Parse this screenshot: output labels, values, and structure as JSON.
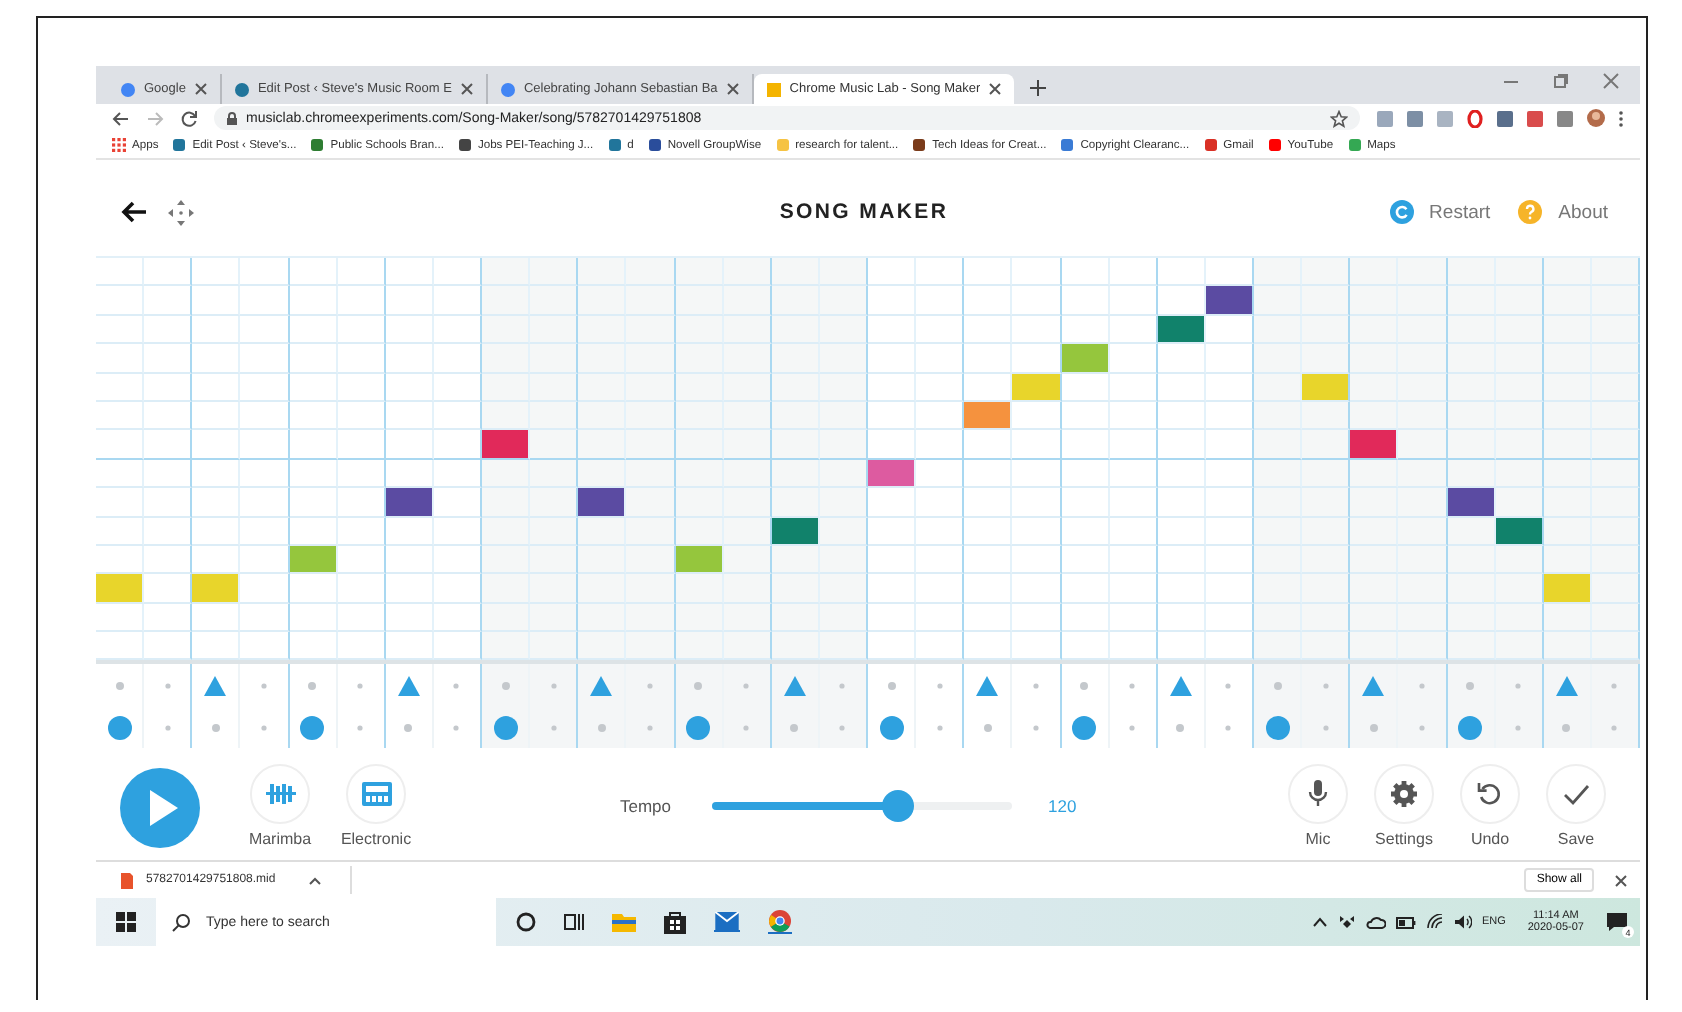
{
  "browser": {
    "tabs": [
      {
        "title": "Google",
        "selected": false
      },
      {
        "title": "Edit Post ‹ Steve's Music Room E",
        "selected": false
      },
      {
        "title": "Celebrating Johann Sebastian Ba",
        "selected": false
      },
      {
        "title": "Chrome Music Lab - Song Maker",
        "selected": true
      }
    ],
    "url": "musiclab.chromeexperiments.com/Song-Maker/song/5782701429751808",
    "bookmarks": [
      "Apps",
      "Edit Post ‹ Steve's...",
      "Public Schools Bran...",
      "Jobs PEI-Teaching J...",
      "d",
      "Novell GroupWise",
      "research for talent...",
      "Tech Ideas for Creat...",
      "Copyright Clearanc...",
      "Gmail",
      "YouTube",
      "Maps"
    ]
  },
  "app": {
    "title": "SONG MAKER",
    "header_actions": [
      {
        "label": "Restart",
        "kind": "restart"
      },
      {
        "label": "About",
        "kind": "about"
      }
    ]
  },
  "melody": {
    "rows": [
      {
        "on": [
          false,
          false,
          false,
          false,
          false,
          false,
          false,
          false,
          false,
          false,
          false,
          false,
          false,
          false,
          false,
          false,
          false,
          false,
          false,
          false,
          false,
          false,
          false,
          false,
          false,
          false,
          false,
          false,
          false,
          false,
          false,
          false
        ]
      },
      {
        "color": "#5b4ba2",
        "on": [
          false,
          false,
          false,
          false,
          false,
          false,
          false,
          false,
          false,
          false,
          false,
          false,
          false,
          false,
          false,
          false,
          false,
          false,
          false,
          false,
          false,
          false,
          false,
          true,
          false,
          false,
          false,
          false,
          false,
          false,
          false,
          false
        ]
      },
      {
        "color": "#11826b",
        "on": [
          false,
          false,
          false,
          false,
          false,
          false,
          false,
          false,
          false,
          false,
          false,
          false,
          false,
          false,
          false,
          false,
          false,
          false,
          false,
          false,
          false,
          false,
          true,
          false,
          false,
          false,
          false,
          false,
          false,
          false,
          false,
          false
        ]
      },
      {
        "color": "#95c63d",
        "on": [
          false,
          false,
          false,
          false,
          false,
          false,
          false,
          false,
          false,
          false,
          false,
          false,
          false,
          false,
          false,
          false,
          false,
          false,
          false,
          false,
          true,
          false,
          false,
          false,
          false,
          false,
          false,
          false,
          false,
          false,
          false,
          false
        ]
      },
      {
        "color": "#e8d52b",
        "on": [
          false,
          false,
          false,
          false,
          false,
          false,
          false,
          false,
          false,
          false,
          false,
          false,
          false,
          false,
          false,
          false,
          false,
          false,
          false,
          true,
          false,
          false,
          false,
          false,
          false,
          true,
          false,
          false,
          false,
          false,
          false,
          false
        ]
      },
      {
        "color": "#f5923e",
        "on": [
          false,
          false,
          false,
          false,
          false,
          false,
          false,
          false,
          false,
          false,
          false,
          false,
          false,
          false,
          false,
          false,
          false,
          false,
          true,
          false,
          false,
          false,
          false,
          false,
          false,
          false,
          false,
          false,
          false,
          false,
          false,
          false
        ]
      },
      {
        "color": "#e1295a",
        "on": [
          false,
          false,
          false,
          false,
          false,
          false,
          false,
          false,
          true,
          false,
          false,
          false,
          false,
          false,
          false,
          false,
          false,
          false,
          false,
          false,
          false,
          false,
          false,
          false,
          false,
          false,
          true,
          false,
          false,
          false,
          false,
          false
        ]
      },
      {
        "color": "#dd5ba0",
        "on": [
          false,
          false,
          false,
          false,
          false,
          false,
          false,
          false,
          false,
          false,
          false,
          false,
          false,
          false,
          false,
          false,
          true,
          false,
          false,
          false,
          false,
          false,
          false,
          false,
          false,
          false,
          false,
          false,
          false,
          false,
          false,
          false
        ]
      },
      {
        "color": "#5b4ba2",
        "on": [
          false,
          false,
          false,
          false,
          false,
          false,
          true,
          false,
          false,
          false,
          true,
          false,
          false,
          false,
          false,
          false,
          false,
          false,
          false,
          false,
          false,
          false,
          false,
          false,
          false,
          false,
          false,
          false,
          true,
          false,
          false,
          false
        ]
      },
      {
        "color": "#11826b",
        "on": [
          false,
          false,
          false,
          false,
          false,
          false,
          false,
          false,
          false,
          false,
          false,
          false,
          false,
          false,
          true,
          false,
          false,
          false,
          false,
          false,
          false,
          false,
          false,
          false,
          false,
          false,
          false,
          false,
          false,
          true,
          false,
          false
        ]
      },
      {
        "color": "#95c63d",
        "on": [
          false,
          false,
          false,
          false,
          true,
          false,
          false,
          false,
          false,
          false,
          false,
          false,
          true,
          false,
          false,
          false,
          false,
          false,
          false,
          false,
          false,
          false,
          false,
          false,
          false,
          false,
          false,
          false,
          false,
          false,
          false,
          false
        ]
      },
      {
        "color": "#e8d52b",
        "on": [
          true,
          false,
          true,
          false,
          false,
          false,
          false,
          false,
          false,
          false,
          false,
          false,
          false,
          false,
          false,
          false,
          false,
          false,
          false,
          false,
          false,
          false,
          false,
          false,
          false,
          false,
          false,
          false,
          false,
          false,
          true,
          false
        ]
      },
      {
        "on": [
          false,
          false,
          false,
          false,
          false,
          false,
          false,
          false,
          false,
          false,
          false,
          false,
          false,
          false,
          false,
          false,
          false,
          false,
          false,
          false,
          false,
          false,
          false,
          false,
          false,
          false,
          false,
          false,
          false,
          false,
          false,
          false
        ]
      },
      {
        "on": [
          false,
          false,
          false,
          false,
          false,
          false,
          false,
          false,
          false,
          false,
          false,
          false,
          false,
          false,
          false,
          false,
          false,
          false,
          false,
          false,
          false,
          false,
          false,
          false,
          false,
          false,
          false,
          false,
          false,
          false,
          false,
          false
        ]
      }
    ]
  },
  "rhythm": {
    "rows": [
      {
        "kind": "triangle",
        "on": [
          false,
          false,
          true,
          false,
          false,
          false,
          true,
          false,
          false,
          false,
          true,
          false,
          false,
          false,
          true,
          false,
          false,
          false,
          true,
          false,
          false,
          false,
          true,
          false,
          false,
          false,
          true,
          false,
          false,
          false,
          true,
          false
        ]
      },
      {
        "kind": "circle",
        "on": [
          true,
          false,
          false,
          false,
          true,
          false,
          false,
          false,
          true,
          false,
          false,
          false,
          true,
          false,
          false,
          false,
          true,
          false,
          false,
          false,
          true,
          false,
          false,
          false,
          true,
          false,
          false,
          false,
          true,
          false,
          false,
          false
        ]
      }
    ]
  },
  "controls": {
    "instruments": [
      {
        "label": "Marimba",
        "kind": "marimba"
      },
      {
        "label": "Electronic",
        "kind": "electronic"
      }
    ],
    "tempo": {
      "label": "Tempo",
      "level": 0.62,
      "reading": "120"
    },
    "actions": [
      {
        "label": "Mic",
        "kind": "mic"
      },
      {
        "label": "Settings",
        "kind": "settings"
      },
      {
        "label": "Undo",
        "kind": "undo"
      },
      {
        "label": "Save",
        "kind": "save"
      }
    ]
  },
  "download_bar": {
    "file": "5782701429751808.mid",
    "show_all": "Show all"
  },
  "taskbar": {
    "search_placeholder": "Type here to search",
    "language": "ENG",
    "time": "11:14 AM",
    "date": "2020-05-07",
    "notifications": "4"
  }
}
